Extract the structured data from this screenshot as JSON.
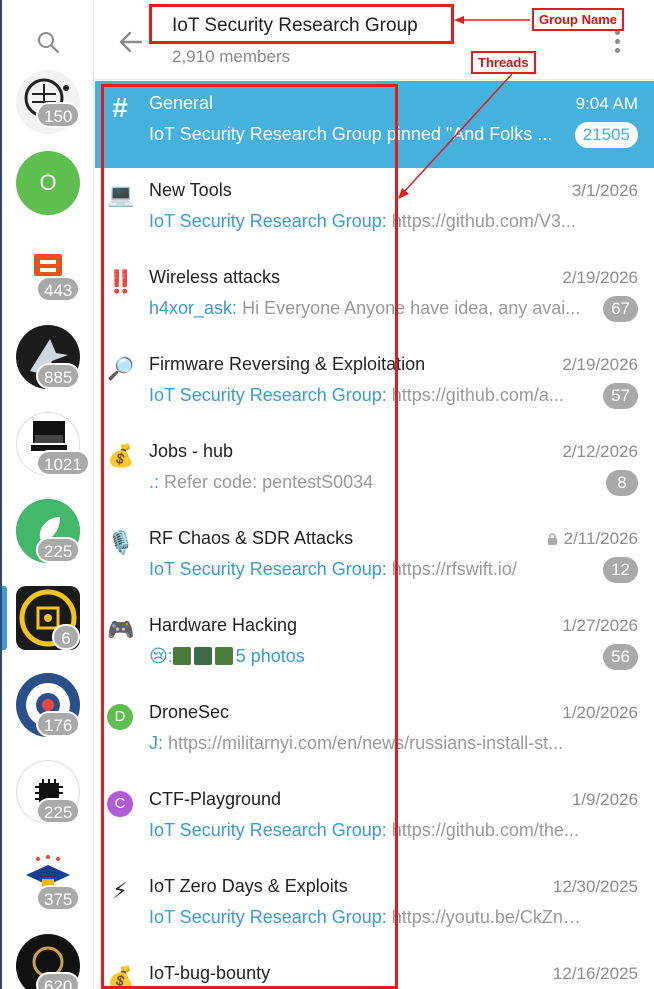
{
  "rail": {
    "avatars": [
      {
        "badge": "150",
        "color": "#f0f0f0"
      },
      {
        "badge": "",
        "letter": "O",
        "color": "#5fbf4e"
      },
      {
        "badge": "443",
        "color": "#ffffff"
      },
      {
        "badge": "885",
        "color": "#1c1c1c"
      },
      {
        "badge": "1021",
        "color": "#ffffff"
      },
      {
        "badge": "225",
        "color": "#43b86a"
      },
      {
        "badge": "6",
        "color": "#1a1a1a"
      },
      {
        "badge": "176",
        "color": "#2a4f8a"
      },
      {
        "badge": "225",
        "color": "#ffffff"
      },
      {
        "badge": "375",
        "color": "#ffffff"
      },
      {
        "badge": "620",
        "color": "#111111"
      }
    ]
  },
  "header": {
    "title": "IoT Security Research Group",
    "members": "2,910 members"
  },
  "threads": [
    {
      "icon": "#",
      "icon_name": "hash-icon",
      "name": "General",
      "date": "9:04 AM",
      "sender": "IoT Security Research Group",
      "text": " pinned \"And Folks ...",
      "count": "21505",
      "active": true
    },
    {
      "icon": "💻",
      "icon_name": "laptop-icon",
      "name": "New Tools",
      "date": "3/1/2026",
      "sender": "IoT Security Research Group:",
      "text": " https://github.com/V3...",
      "count": ""
    },
    {
      "icon": "‼️",
      "icon_name": "double-exclamation-icon",
      "name": "Wireless attacks",
      "date": "2/19/2026",
      "sender": "h4xor_ask:",
      "text": " Hi Everyone  Anyone have idea, any avai...",
      "count": "67"
    },
    {
      "icon": "🔎",
      "icon_name": "magnifier-icon",
      "name": "Firmware Reversing & Exploitation",
      "date": "2/19/2026",
      "sender": "IoT Security Research Group:",
      "text": " https://github.com/a...",
      "count": "57"
    },
    {
      "icon": "💰",
      "icon_name": "money-bag-icon",
      "name": "Jobs - hub",
      "date": "2/12/2026",
      "sender": ".:",
      "text": " Refer code: pentestS0034",
      "count": "8"
    },
    {
      "icon": "🎙️",
      "icon_name": "microphone-icon",
      "name": "RF Chaos & SDR Attacks",
      "date": "2/11/2026",
      "sender": "IoT Security Research Group:",
      "text": " https://rfswift.io/",
      "count": "12",
      "locked": true
    },
    {
      "icon": "🎮",
      "icon_name": "gamepad-icon",
      "name": "Hardware Hacking",
      "date": "1/27/2026",
      "sender": "😢:",
      "text": "",
      "link": "5 photos",
      "count": "56"
    },
    {
      "icon": "D",
      "icon_name": "dronesec-letter-icon",
      "name": "DroneSec",
      "date": "1/20/2026",
      "sender": "J:",
      "text": " https://militarnyi.com/en/news/russians-install-st...",
      "count": ""
    },
    {
      "icon": "C",
      "icon_name": "ctf-letter-icon",
      "name": "CTF-Playground",
      "date": "1/9/2026",
      "sender": "IoT Security Research Group:",
      "text": " https://github.com/the...",
      "count": ""
    },
    {
      "icon": "⚡",
      "icon_name": "lightning-icon",
      "name": "IoT Zero Days & Exploits",
      "date": "12/30/2025",
      "sender": "IoT Security Research Group:",
      "text": " https://youtu.be/CkZn_SZP...",
      "count": ""
    },
    {
      "icon": "💰",
      "icon_name": "money-bag-icon",
      "name": "IoT-bug-bounty",
      "date": "12/16/2025",
      "sender": "",
      "text": "",
      "count": ""
    }
  ],
  "annotations": {
    "group_name_label": "Group Name",
    "threads_label": "Threads"
  },
  "colors": {
    "accent": "#45b1dd",
    "link": "#3a9bd5",
    "annotation": "#e41c1c",
    "d_icon": "#5fbf4e",
    "c_icon": "#b05ad6"
  }
}
